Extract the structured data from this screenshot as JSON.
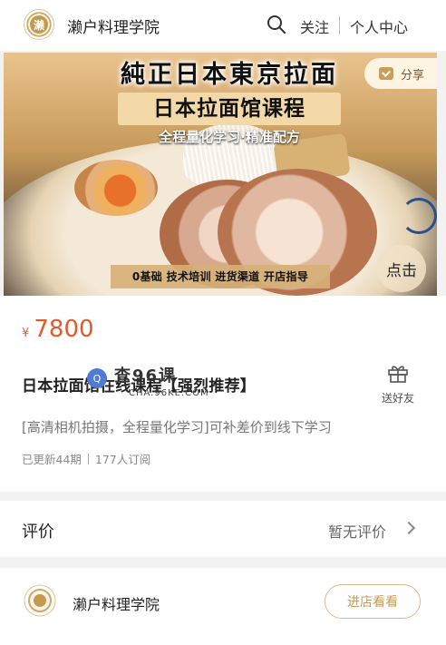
{
  "header": {
    "brand": "濑户料理学院",
    "logo_char": "濑",
    "search_icon": "search-icon",
    "follow_label": "关注",
    "user_center_label": "个人中心"
  },
  "banner": {
    "title_line1": "純正日本東京拉面",
    "title_line2": "日本拉面馆课程",
    "title_line3": "全程量化学习·精准配方",
    "tags": "0基础  技术培训  进货渠道  开店指导",
    "stamp_text": "点击",
    "share_label": "分享"
  },
  "product": {
    "price_symbol": "¥",
    "price": "7800",
    "title": "日本拉面馆在线课程【强烈推荐】",
    "description": "[高清相机拍摄，全程量化学习]可补差价到线下学习",
    "updated": "已更新44期",
    "subscribers": "177人订阅",
    "gift_label": "送好友"
  },
  "watermark": {
    "cn": "查96课",
    "en": "CHA.96KE.COM"
  },
  "review": {
    "label": "评价",
    "value": "暂无评价"
  },
  "shop": {
    "name": "濑户料理学院",
    "button": "进店看看"
  },
  "colors": {
    "price": "#e35b2d",
    "accent_gold": "#c49b5b"
  }
}
